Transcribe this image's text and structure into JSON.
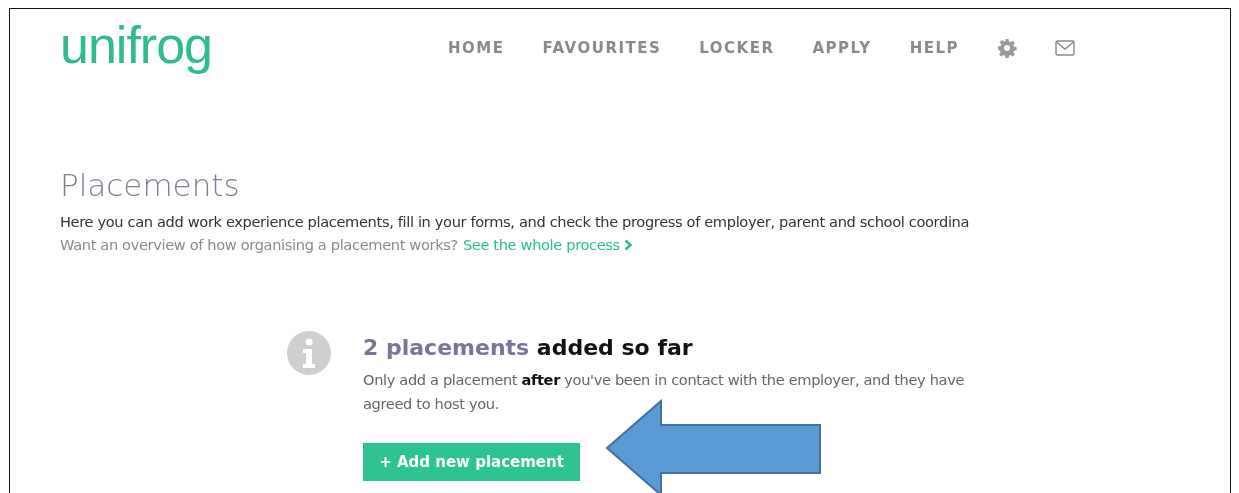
{
  "header": {
    "logo": "unifrog",
    "nav": [
      {
        "label": "HOME"
      },
      {
        "label": "FAVOURITES"
      },
      {
        "label": "LOCKER"
      },
      {
        "label": "APPLY"
      },
      {
        "label": "HELP"
      }
    ]
  },
  "page": {
    "title": "Placements",
    "intro": "Here you can add work experience placements, fill in your forms, and check the progress of employer, parent and school coordina",
    "overview": "Want an overview of how organising a placement works?",
    "overview_link": "See the whole process"
  },
  "summary": {
    "count": "2 placements",
    "heading_rest": "added so far",
    "note": "Only add a placement **after** you've been in contact with the employer, and they have agreed to host you.",
    "button": "+ Add new placement"
  }
}
